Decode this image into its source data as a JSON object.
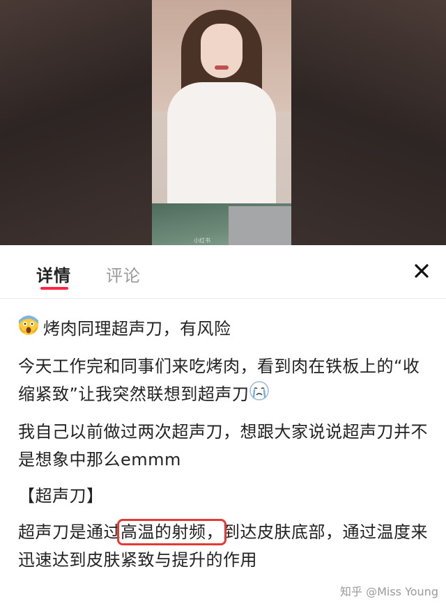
{
  "tabs": [
    {
      "label": "详情",
      "active": true
    },
    {
      "label": "评论",
      "active": false
    }
  ],
  "close_icon": "close-icon",
  "media": {
    "watermark": "小红书"
  },
  "content": {
    "title_emoji": "scream-emoji",
    "title": "烤肉同理超声刀，有风险",
    "p1_line": "今天工作完和同事们来吃烤肉，看到肉在铁板上的“收缩紧致”让我突然联想到超声刀",
    "p1_emoji": "crying-emoji",
    "p2": "我自己以前做过两次超声刀，想跟大家说说超声刀并不是想象中那么emmm",
    "section_heading": "【超声刀】",
    "p3_before": "超声刀是通过",
    "p3_highlight": "高温的射频，",
    "p3_after": "到达皮肤底部，通过温度来迅速达到皮肤紧致与提升的作用"
  },
  "footer": {
    "watermark_text": "知乎 @Miss Young"
  },
  "colors": {
    "accent": "#ff2442",
    "highlight_box": "#e53935",
    "tab_inactive": "#9a9a9a"
  }
}
